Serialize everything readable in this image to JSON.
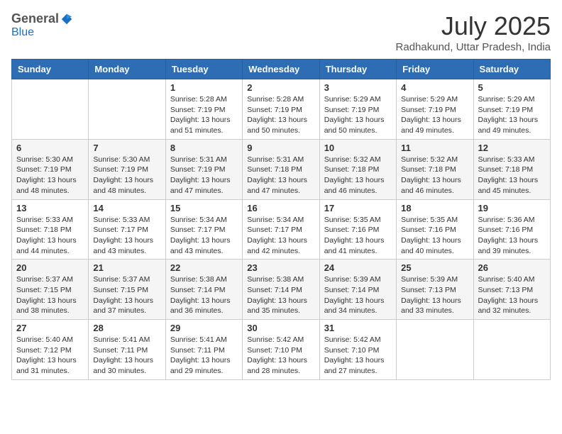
{
  "logo": {
    "general": "General",
    "blue": "Blue"
  },
  "header": {
    "title": "July 2025",
    "subtitle": "Radhakund, Uttar Pradesh, India"
  },
  "days_of_week": [
    "Sunday",
    "Monday",
    "Tuesday",
    "Wednesday",
    "Thursday",
    "Friday",
    "Saturday"
  ],
  "weeks": [
    [
      null,
      null,
      {
        "day": 1,
        "sunrise": "5:28 AM",
        "sunset": "7:19 PM",
        "daylight": "13 hours and 51 minutes."
      },
      {
        "day": 2,
        "sunrise": "5:28 AM",
        "sunset": "7:19 PM",
        "daylight": "13 hours and 50 minutes."
      },
      {
        "day": 3,
        "sunrise": "5:29 AM",
        "sunset": "7:19 PM",
        "daylight": "13 hours and 50 minutes."
      },
      {
        "day": 4,
        "sunrise": "5:29 AM",
        "sunset": "7:19 PM",
        "daylight": "13 hours and 49 minutes."
      },
      {
        "day": 5,
        "sunrise": "5:29 AM",
        "sunset": "7:19 PM",
        "daylight": "13 hours and 49 minutes."
      }
    ],
    [
      {
        "day": 6,
        "sunrise": "5:30 AM",
        "sunset": "7:19 PM",
        "daylight": "13 hours and 48 minutes."
      },
      {
        "day": 7,
        "sunrise": "5:30 AM",
        "sunset": "7:19 PM",
        "daylight": "13 hours and 48 minutes."
      },
      {
        "day": 8,
        "sunrise": "5:31 AM",
        "sunset": "7:19 PM",
        "daylight": "13 hours and 47 minutes."
      },
      {
        "day": 9,
        "sunrise": "5:31 AM",
        "sunset": "7:18 PM",
        "daylight": "13 hours and 47 minutes."
      },
      {
        "day": 10,
        "sunrise": "5:32 AM",
        "sunset": "7:18 PM",
        "daylight": "13 hours and 46 minutes."
      },
      {
        "day": 11,
        "sunrise": "5:32 AM",
        "sunset": "7:18 PM",
        "daylight": "13 hours and 46 minutes."
      },
      {
        "day": 12,
        "sunrise": "5:33 AM",
        "sunset": "7:18 PM",
        "daylight": "13 hours and 45 minutes."
      }
    ],
    [
      {
        "day": 13,
        "sunrise": "5:33 AM",
        "sunset": "7:18 PM",
        "daylight": "13 hours and 44 minutes."
      },
      {
        "day": 14,
        "sunrise": "5:33 AM",
        "sunset": "7:17 PM",
        "daylight": "13 hours and 43 minutes."
      },
      {
        "day": 15,
        "sunrise": "5:34 AM",
        "sunset": "7:17 PM",
        "daylight": "13 hours and 43 minutes."
      },
      {
        "day": 16,
        "sunrise": "5:34 AM",
        "sunset": "7:17 PM",
        "daylight": "13 hours and 42 minutes."
      },
      {
        "day": 17,
        "sunrise": "5:35 AM",
        "sunset": "7:16 PM",
        "daylight": "13 hours and 41 minutes."
      },
      {
        "day": 18,
        "sunrise": "5:35 AM",
        "sunset": "7:16 PM",
        "daylight": "13 hours and 40 minutes."
      },
      {
        "day": 19,
        "sunrise": "5:36 AM",
        "sunset": "7:16 PM",
        "daylight": "13 hours and 39 minutes."
      }
    ],
    [
      {
        "day": 20,
        "sunrise": "5:37 AM",
        "sunset": "7:15 PM",
        "daylight": "13 hours and 38 minutes."
      },
      {
        "day": 21,
        "sunrise": "5:37 AM",
        "sunset": "7:15 PM",
        "daylight": "13 hours and 37 minutes."
      },
      {
        "day": 22,
        "sunrise": "5:38 AM",
        "sunset": "7:14 PM",
        "daylight": "13 hours and 36 minutes."
      },
      {
        "day": 23,
        "sunrise": "5:38 AM",
        "sunset": "7:14 PM",
        "daylight": "13 hours and 35 minutes."
      },
      {
        "day": 24,
        "sunrise": "5:39 AM",
        "sunset": "7:14 PM",
        "daylight": "13 hours and 34 minutes."
      },
      {
        "day": 25,
        "sunrise": "5:39 AM",
        "sunset": "7:13 PM",
        "daylight": "13 hours and 33 minutes."
      },
      {
        "day": 26,
        "sunrise": "5:40 AM",
        "sunset": "7:13 PM",
        "daylight": "13 hours and 32 minutes."
      }
    ],
    [
      {
        "day": 27,
        "sunrise": "5:40 AM",
        "sunset": "7:12 PM",
        "daylight": "13 hours and 31 minutes."
      },
      {
        "day": 28,
        "sunrise": "5:41 AM",
        "sunset": "7:11 PM",
        "daylight": "13 hours and 30 minutes."
      },
      {
        "day": 29,
        "sunrise": "5:41 AM",
        "sunset": "7:11 PM",
        "daylight": "13 hours and 29 minutes."
      },
      {
        "day": 30,
        "sunrise": "5:42 AM",
        "sunset": "7:10 PM",
        "daylight": "13 hours and 28 minutes."
      },
      {
        "day": 31,
        "sunrise": "5:42 AM",
        "sunset": "7:10 PM",
        "daylight": "13 hours and 27 minutes."
      },
      null,
      null
    ]
  ],
  "labels": {
    "sunrise": "Sunrise:",
    "sunset": "Sunset:",
    "daylight": "Daylight:"
  }
}
